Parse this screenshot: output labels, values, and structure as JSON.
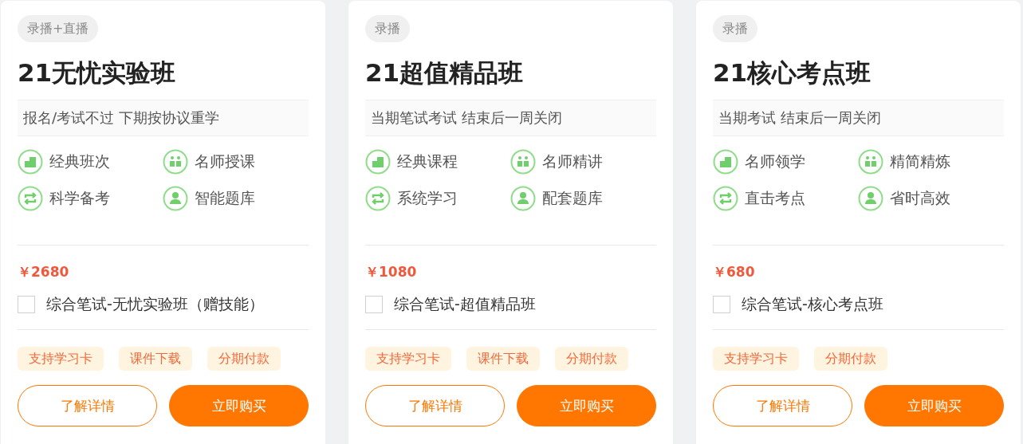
{
  "courses": [
    {
      "badge": "录播+直播",
      "title": "21无忧实验班",
      "promo": "报名/考试不过 下期按协议重学",
      "features": [
        {
          "kind": "building",
          "label": "经典班次"
        },
        {
          "kind": "team",
          "label": "名师授课"
        },
        {
          "kind": "repeat",
          "label": "科学备考"
        },
        {
          "kind": "person",
          "label": "智能题库"
        }
      ],
      "price": "￥2680",
      "option": {
        "label": "综合笔试-无忧实验班（赠技能）",
        "checked": false
      },
      "tags": [
        "支持学习卡",
        "课件下载",
        "分期付款"
      ],
      "buttons": {
        "details": "了解详情",
        "buy": "立即购买"
      }
    },
    {
      "badge": "录播",
      "title": "21超值精品班",
      "promo": "当期笔试考试 结束后一周关闭",
      "features": [
        {
          "kind": "building",
          "label": "经典课程"
        },
        {
          "kind": "team",
          "label": "名师精讲"
        },
        {
          "kind": "repeat",
          "label": "系统学习"
        },
        {
          "kind": "person",
          "label": "配套题库"
        }
      ],
      "price": "￥1080",
      "option": {
        "label": "综合笔试-超值精品班",
        "checked": false
      },
      "tags": [
        "支持学习卡",
        "课件下载",
        "分期付款"
      ],
      "buttons": {
        "details": "了解详情",
        "buy": "立即购买"
      }
    },
    {
      "badge": "录播",
      "title": "21核心考点班",
      "promo": "当期考试 结束后一周关闭",
      "features": [
        {
          "kind": "building",
          "label": "名师领学"
        },
        {
          "kind": "team",
          "label": "精简精炼"
        },
        {
          "kind": "repeat",
          "label": "直击考点"
        },
        {
          "kind": "person",
          "label": "省时高效"
        }
      ],
      "price": "￥680",
      "option": {
        "label": "综合笔试-核心考点班",
        "checked": false
      },
      "tags": [
        "支持学习卡",
        "分期付款"
      ],
      "buttons": {
        "details": "了解详情",
        "buy": "立即购买"
      }
    }
  ]
}
